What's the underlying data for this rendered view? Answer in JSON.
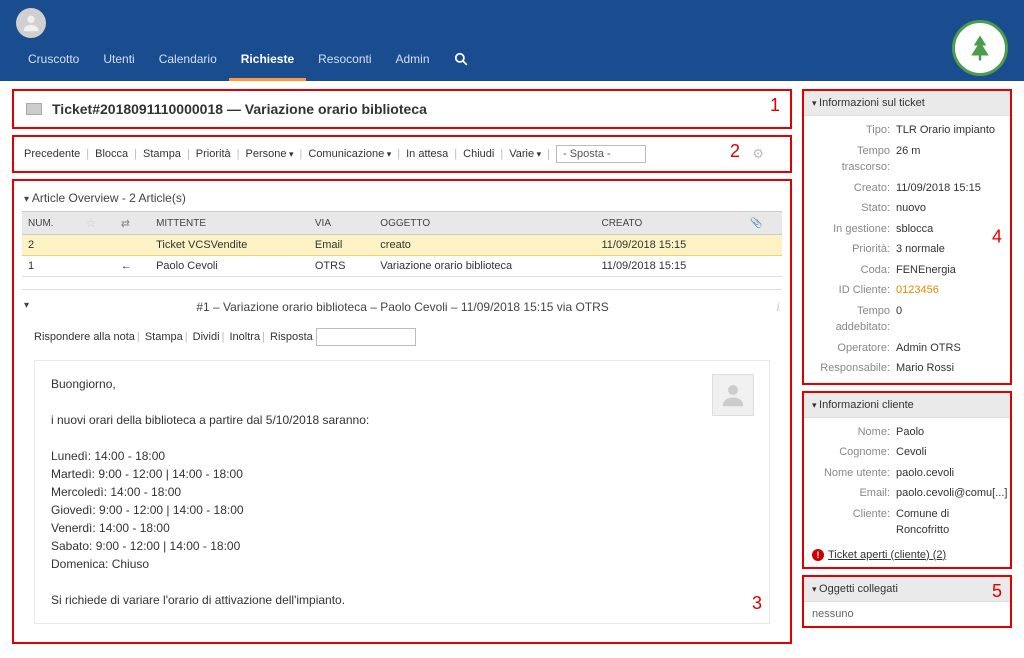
{
  "nav": {
    "items": [
      "Cruscotto",
      "Utenti",
      "Calendario",
      "Richieste",
      "Resoconti",
      "Admin"
    ],
    "active_index": 3
  },
  "title": {
    "text": "Ticket#2018091110000018 — Variazione orario biblioteca",
    "marker": "1"
  },
  "actions": {
    "items": [
      "Precedente",
      "Blocca",
      "Stampa",
      "Priorità",
      "Persone",
      "Comunicazione",
      "In attesa",
      "Chiudi",
      "Varie"
    ],
    "dropdown_indices": [
      4,
      5,
      8
    ],
    "move_placeholder": "- Sposta -",
    "marker": "2"
  },
  "article_overview": {
    "header": "Article Overview - 2 Article(s)",
    "columns": [
      "NUM.",
      "",
      "",
      "MITTENTE",
      "VIA",
      "OGGETTO",
      "CREATO",
      ""
    ],
    "rows": [
      {
        "num": "2",
        "dir": "swap",
        "sender": "Ticket VCSVendite",
        "via": "Email",
        "subject": "creato",
        "created": "11/09/2018 15:15",
        "highlight": true
      },
      {
        "num": "1",
        "dir": "in",
        "sender": "Paolo Cevoli",
        "via": "OTRS",
        "subject": "Variazione orario biblioteca",
        "created": "11/09/2018 15:15",
        "highlight": false
      }
    ]
  },
  "article_detail": {
    "header": "#1 – Variazione orario biblioteca – Paolo Cevoli – 11/09/2018 15:15 via OTRS",
    "sub_actions": [
      "Rispondere alla nota",
      "Stampa",
      "Dividi",
      "Inoltra",
      "Risposta"
    ],
    "body": {
      "greeting": "Buongiorno,",
      "intro": "i nuovi orari della biblioteca a partire dal 5/10/2018 saranno:",
      "lines": [
        "Lunedì: 14:00 - 18:00",
        "Martedì: 9:00 - 12:00 | 14:00 - 18:00",
        "Mercoledì: 14:00 - 18:00",
        "Giovedì: 9:00 - 12:00 | 14:00 - 18:00",
        "Venerdì: 14:00 - 18:00",
        "Sabato: 9:00 - 12:00 | 14:00 - 18:00",
        "Domenica: Chiuso"
      ],
      "closing": "Si richiede di variare l'orario di attivazione dell'impianto."
    },
    "marker": "3"
  },
  "ticket_info": {
    "title": "Informazioni sul ticket",
    "rows": [
      {
        "label": "Tipo:",
        "value": "TLR Orario impianto"
      },
      {
        "label": "Tempo trascorso:",
        "value": "26 m"
      },
      {
        "label": "Creato:",
        "value": "11/09/2018 15:15"
      },
      {
        "label": "Stato:",
        "value": "nuovo"
      },
      {
        "label": "In gestione:",
        "value": "sblocca"
      },
      {
        "label": "Priorità:",
        "value": "3 normale"
      },
      {
        "label": "Coda:",
        "value": "FENEnergia"
      },
      {
        "label": "ID Cliente:",
        "value": "0123456",
        "orange": true
      },
      {
        "label": "Tempo addebitato:",
        "value": "0"
      },
      {
        "label": "Operatore:",
        "value": "Admin OTRS"
      },
      {
        "label": "Responsabile:",
        "value": "Mario Rossi"
      }
    ],
    "marker": "4"
  },
  "customer_info": {
    "title": "Informazioni cliente",
    "rows": [
      {
        "label": "Nome:",
        "value": "Paolo"
      },
      {
        "label": "Cognome:",
        "value": "Cevoli"
      },
      {
        "label": "Nome utente:",
        "value": "paolo.cevoli"
      },
      {
        "label": "Email:",
        "value": "paolo.cevoli@comu[...]"
      },
      {
        "label": "Cliente:",
        "value": "Comune di Roncofritto"
      }
    ],
    "open_tickets": "Ticket aperti (cliente) (2)"
  },
  "linked_objects": {
    "title": "Oggetti collegati",
    "none": "nessuno",
    "marker": "5"
  }
}
